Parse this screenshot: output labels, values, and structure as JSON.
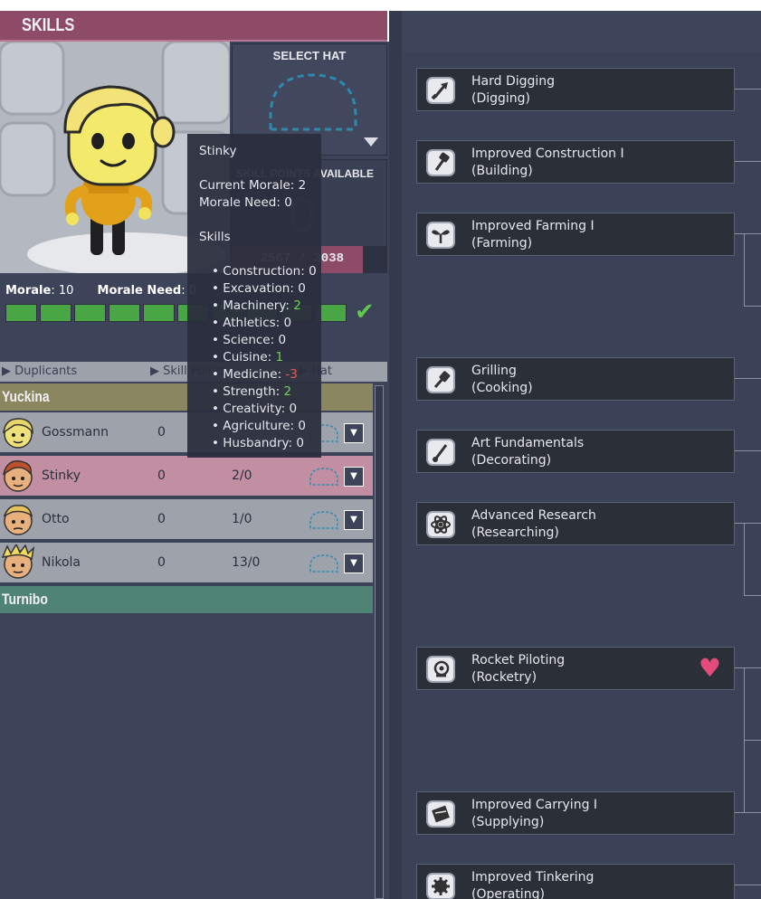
{
  "header": {
    "title": "SKILLS"
  },
  "hat": {
    "label": "SELECT HAT"
  },
  "skill_points": {
    "label": "SKILL POINTS AVAILABLE",
    "value": "0",
    "xp_text": "2567 / 3038",
    "xp_fraction": 0.845
  },
  "morale": {
    "morale_label": "Morale",
    "morale_value": "10",
    "need_label": "Morale Need",
    "need_value": "0",
    "boxes_filled": 10
  },
  "columns": {
    "duplicants": "Duplicants",
    "skill_points": "Skill Points",
    "hat": "Hat"
  },
  "groups": [
    {
      "name": "Yuckina",
      "color": "#8a8760"
    },
    {
      "name": "Turnibo",
      "color": "#4f8474"
    }
  ],
  "duplicants": [
    {
      "name": "Gossmann",
      "points": "0",
      "morale": "",
      "bg": "#9ea2ab"
    },
    {
      "name": "Stinky",
      "points": "0",
      "morale": "2/0",
      "bg": "#c28fa2"
    },
    {
      "name": "Otto",
      "points": "0",
      "morale": "1/0",
      "bg": "#9ea2ab"
    },
    {
      "name": "Nikola",
      "points": "0",
      "morale": "13/0",
      "bg": "#9ea2ab"
    }
  ],
  "tooltip": {
    "name": "Stinky",
    "current_morale": "Current Morale: 2",
    "morale_need": "Morale Need: 0",
    "skills_heading": "Skills",
    "skills": [
      {
        "label": "Construction: ",
        "value": "0",
        "tone": "neutral"
      },
      {
        "label": "Excavation: ",
        "value": "0",
        "tone": "neutral"
      },
      {
        "label": "Machinery: ",
        "value": "2",
        "tone": "pos"
      },
      {
        "label": "Athletics: ",
        "value": "0",
        "tone": "neutral"
      },
      {
        "label": "Science: ",
        "value": "0",
        "tone": "neutral"
      },
      {
        "label": "Cuisine: ",
        "value": "1",
        "tone": "pos"
      },
      {
        "label": "Medicine: ",
        "value": "-3",
        "tone": "neg"
      },
      {
        "label": "Strength: ",
        "value": "2",
        "tone": "pos"
      },
      {
        "label": "Creativity: ",
        "value": "0",
        "tone": "neutral"
      },
      {
        "label": "Agriculture: ",
        "value": "0",
        "tone": "neutral"
      },
      {
        "label": "Husbandry: ",
        "value": "0",
        "tone": "neutral"
      }
    ]
  },
  "skill_tree": [
    {
      "name": "Hard Digging",
      "category": "(Digging)",
      "icon": "shovel-icon",
      "liked": false
    },
    {
      "name": "Improved Construction I",
      "category": "(Building)",
      "icon": "hammer-icon",
      "liked": false
    },
    {
      "name": "Improved Farming I",
      "category": "(Farming)",
      "icon": "sprout-icon",
      "liked": false
    },
    {
      "name": "Grilling",
      "category": "(Cooking)",
      "icon": "spatula-icon",
      "liked": false
    },
    {
      "name": "Art Fundamentals",
      "category": "(Decorating)",
      "icon": "brush-icon",
      "liked": false
    },
    {
      "name": "Advanced Research",
      "category": "(Researching)",
      "icon": "atom-icon",
      "liked": false
    },
    {
      "name": "Rocket Piloting",
      "category": "(Rocketry)",
      "icon": "helmet-icon",
      "liked": true
    },
    {
      "name": "Improved Carrying I",
      "category": "(Supplying)",
      "icon": "box-icon",
      "liked": false
    },
    {
      "name": "Improved Tinkering",
      "category": "(Operating)",
      "icon": "gear-icon",
      "liked": false
    }
  ]
}
